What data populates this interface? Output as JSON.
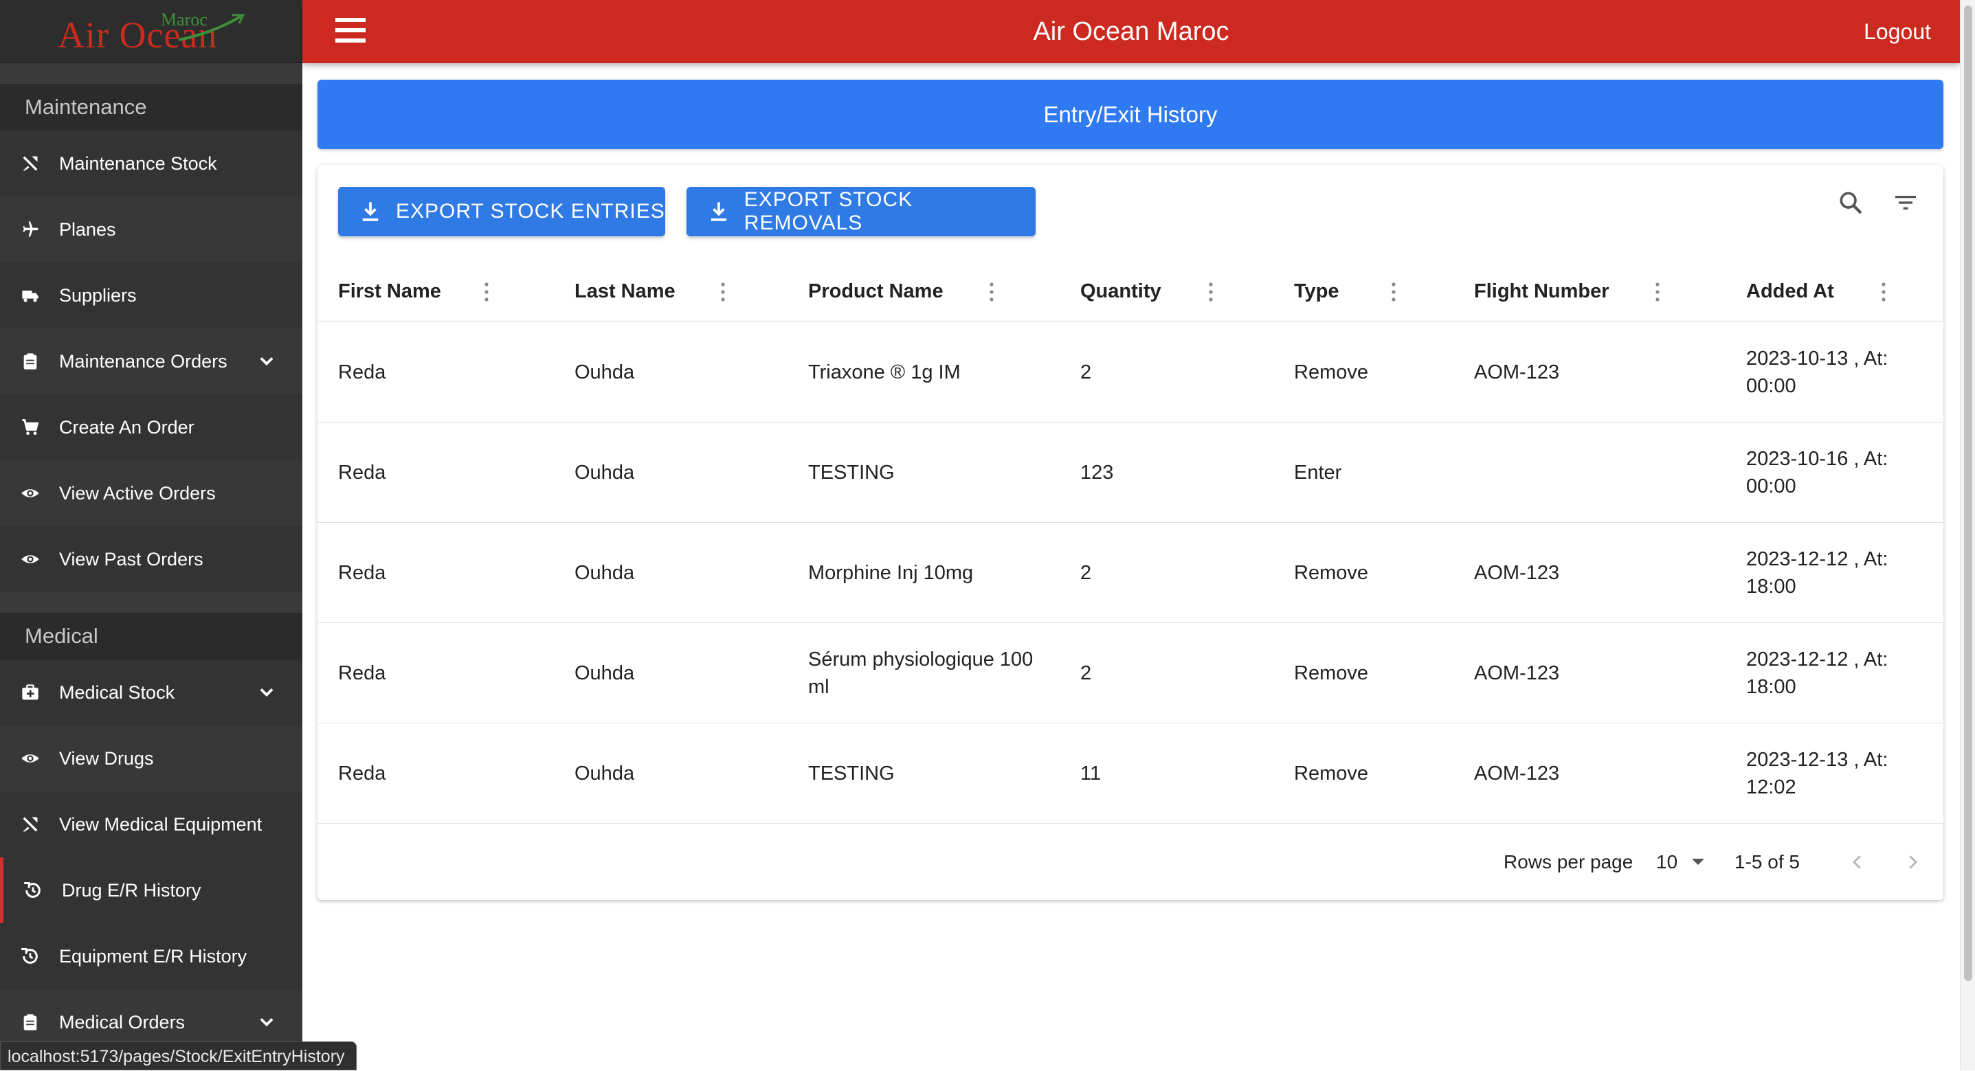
{
  "brand": {
    "logo_main": "Air Ocean",
    "logo_sup": "Maroc"
  },
  "topbar": {
    "title": "Air Ocean Maroc",
    "logout": "Logout"
  },
  "sidebar": {
    "maintenance_header": "Maintenance",
    "maintenance_items": [
      {
        "label": "Maintenance Stock",
        "icon": "tools-icon"
      },
      {
        "label": "Planes",
        "icon": "plane-icon"
      },
      {
        "label": "Suppliers",
        "icon": "truck-icon"
      },
      {
        "label": "Maintenance Orders",
        "icon": "clipboard-icon"
      },
      {
        "label": "Create An Order",
        "icon": "cart-icon"
      },
      {
        "label": "View Active Orders",
        "icon": "eye-icon"
      },
      {
        "label": "View Past Orders",
        "icon": "eye-icon"
      }
    ],
    "medical_header": "Medical",
    "medical_items": [
      {
        "label": "Medical Stock",
        "icon": "medkit-icon"
      },
      {
        "label": "View Drugs",
        "icon": "eye-icon"
      },
      {
        "label": "View Medical Equipment",
        "icon": "tools-icon"
      },
      {
        "label": "Drug E/R History",
        "icon": "history-icon"
      },
      {
        "label": "Equipment E/R History",
        "icon": "history-icon"
      },
      {
        "label": "Medical Orders",
        "icon": "clipboard-icon"
      }
    ]
  },
  "page": {
    "banner": "Entry/Exit History"
  },
  "toolbar": {
    "export_entries": "EXPORT STOCK ENTRIES",
    "export_removals": "EXPORT STOCK REMOVALS"
  },
  "table": {
    "columns": [
      "First Name",
      "Last Name",
      "Product Name",
      "Quantity",
      "Type",
      "Flight Number",
      "Added At"
    ],
    "rows": [
      {
        "first": "Reda",
        "last": "Ouhda",
        "product": "Triaxone ® 1g IM",
        "qty": "2",
        "type": "Remove",
        "flight": "AOM-123",
        "added": "2023-10-13 , At: 00:00"
      },
      {
        "first": "Reda",
        "last": "Ouhda",
        "product": "TESTING",
        "qty": "123",
        "type": "Enter",
        "flight": "",
        "added": "2023-10-16 , At: 00:00"
      },
      {
        "first": "Reda",
        "last": "Ouhda",
        "product": "Morphine Inj 10mg",
        "qty": "2",
        "type": "Remove",
        "flight": "AOM-123",
        "added": "2023-12-12 , At: 18:00"
      },
      {
        "first": "Reda",
        "last": "Ouhda",
        "product": "Sérum physiologique 100 ml",
        "qty": "2",
        "type": "Remove",
        "flight": "AOM-123",
        "added": "2023-12-12 , At: 18:00"
      },
      {
        "first": "Reda",
        "last": "Ouhda",
        "product": "TESTING",
        "qty": "11",
        "type": "Remove",
        "flight": "AOM-123",
        "added": "2023-12-13 , At: 12:02"
      }
    ]
  },
  "pagination": {
    "rows_per_page_label": "Rows per page",
    "rows_per_page_value": "10",
    "range": "1-5 of 5"
  },
  "status_url": "localhost:5173/pages/Stock/ExitEntryHistory",
  "colors": {
    "topbar": "#cc2a20",
    "banner": "#2f7af2",
    "button": "#2f7ae5",
    "sidebar": "#3a3a3a",
    "active_marker": "#d32f2f"
  }
}
